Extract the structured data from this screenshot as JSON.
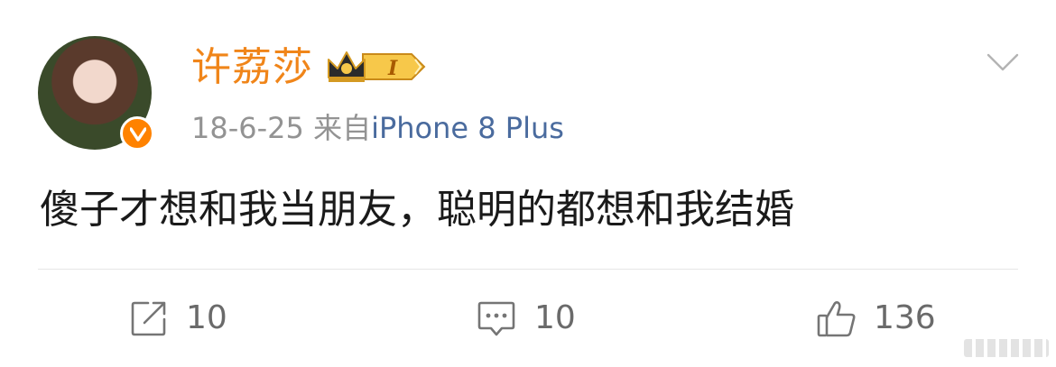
{
  "post": {
    "author": "许荔莎",
    "rank_badge": "I",
    "date": "18-6-25",
    "source_prefix": "来自",
    "source_device": "iPhone 8 Plus",
    "text": "傻子才想和我当朋友，聪明的都想和我结婚"
  },
  "actions": {
    "repost_count": "10",
    "comment_count": "10",
    "like_count": "136"
  },
  "icons": {
    "repost": "repost-icon",
    "comment": "comment-icon",
    "like": "thumbs-up-icon",
    "more": "chevron-down-icon",
    "verified": "verified-v-icon",
    "crown": "crown-icon"
  },
  "colors": {
    "username": "#f08519",
    "device": "#4a6b9e",
    "meta": "#939393",
    "verified": "#ff8200"
  }
}
